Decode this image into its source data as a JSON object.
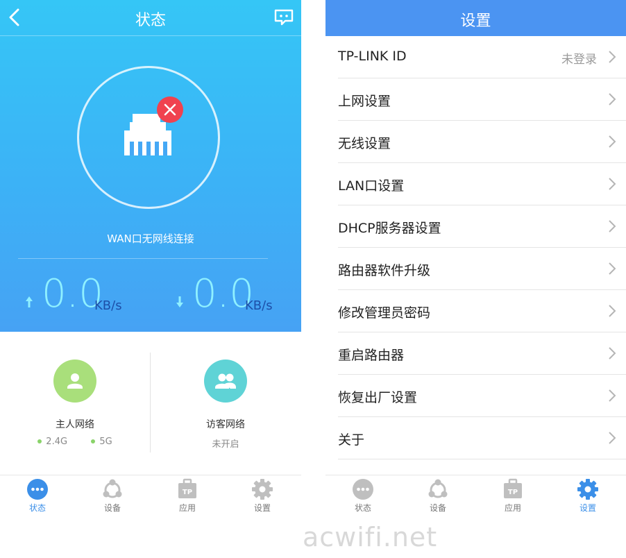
{
  "status_screen": {
    "title": "状态",
    "wan_status": "WAN口无网线连接",
    "upload": {
      "value": "0.0",
      "unit": "KB/s"
    },
    "download": {
      "value": "0.0",
      "unit": "KB/s"
    },
    "host_network": {
      "name": "主人网络",
      "band1": "2.4G",
      "band2": "5G",
      "band_dot_color": "#8ad36a"
    },
    "guest_network": {
      "name": "访客网络",
      "status": "未开启"
    },
    "colors": {
      "gradient_top": "#35c6f6",
      "gradient_bottom": "#46a2f4",
      "speed_number": "#8ff0ff",
      "speed_unit": "#1d4fa8",
      "error_badge": "#f0424f",
      "host_circle": "#a9df7b",
      "guest_circle": "#5fd3d6"
    }
  },
  "settings_screen": {
    "title": "设置",
    "items": [
      {
        "label": "TP-LINK ID",
        "value": "未登录"
      },
      {
        "label": "上网设置"
      },
      {
        "label": "无线设置"
      },
      {
        "label": "LAN口设置"
      },
      {
        "label": "DHCP服务器设置"
      },
      {
        "label": "路由器软件升级"
      },
      {
        "label": "修改管理员密码"
      },
      {
        "label": "重启路由器"
      },
      {
        "label": "恢复出厂设置"
      },
      {
        "label": "关于"
      }
    ],
    "colors": {
      "header": "#4b94f2"
    }
  },
  "tabbar": {
    "tabs": [
      {
        "label": "状态",
        "icon": "status-dots-icon"
      },
      {
        "label": "设备",
        "icon": "devices-icon"
      },
      {
        "label": "应用",
        "icon": "apps-tp-icon"
      },
      {
        "label": "设置",
        "icon": "gear-icon"
      }
    ],
    "active_color": "#3b8fe8",
    "inactive_color": "#bfbfbf"
  },
  "watermark": "acwifi.net"
}
